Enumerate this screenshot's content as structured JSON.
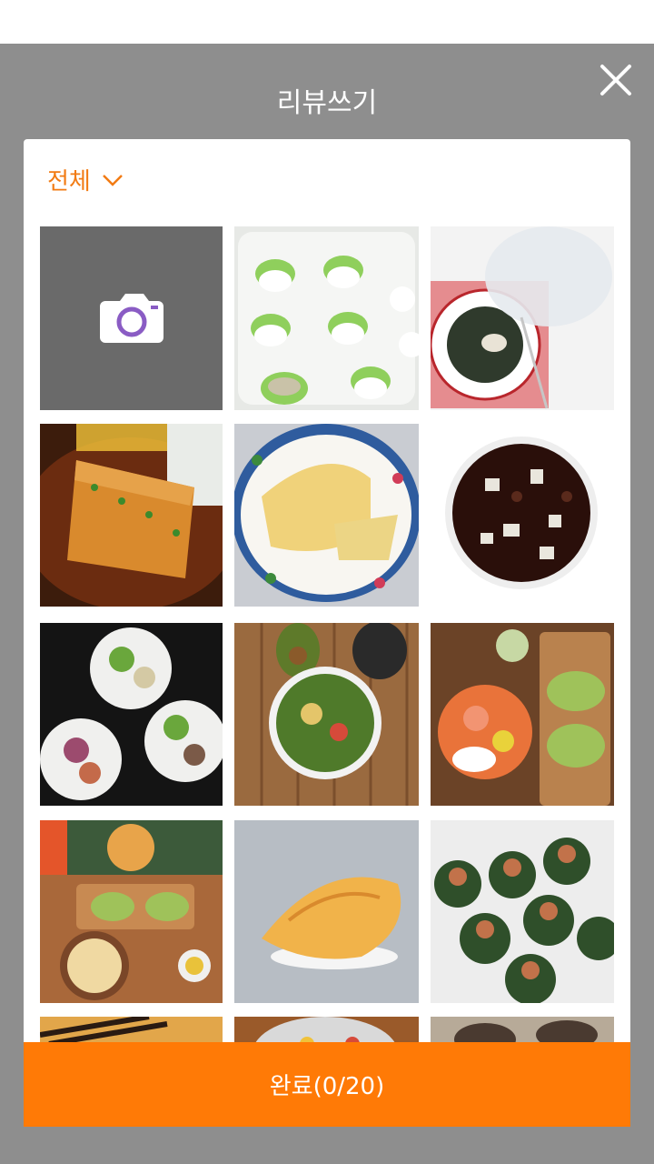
{
  "header": {
    "title": "리뷰쓰기",
    "close_icon": "close-icon"
  },
  "filter": {
    "label": "전체",
    "icon": "chevron-down-icon",
    "color": "#f27b13"
  },
  "camera": {
    "icon": "camera-icon",
    "accent": "#8a5cc4"
  },
  "photos": [
    {
      "name": "photo-dumplings"
    },
    {
      "name": "photo-salad-bowl-cover"
    },
    {
      "name": "photo-katsu-curry"
    },
    {
      "name": "photo-cake-plate"
    },
    {
      "name": "photo-jajang-bowl"
    },
    {
      "name": "photo-salad-bowls-black"
    },
    {
      "name": "photo-avocado-salad"
    },
    {
      "name": "photo-salmon-toast-board"
    },
    {
      "name": "photo-brunch-table"
    },
    {
      "name": "photo-pastry"
    },
    {
      "name": "photo-leaf-wraps"
    },
    {
      "name": "photo-noodles-chopsticks"
    },
    {
      "name": "photo-soup-bowl"
    },
    {
      "name": "photo-tea-set"
    }
  ],
  "done_button": {
    "label": "완료(0/20)",
    "color": "#ff7a06"
  }
}
